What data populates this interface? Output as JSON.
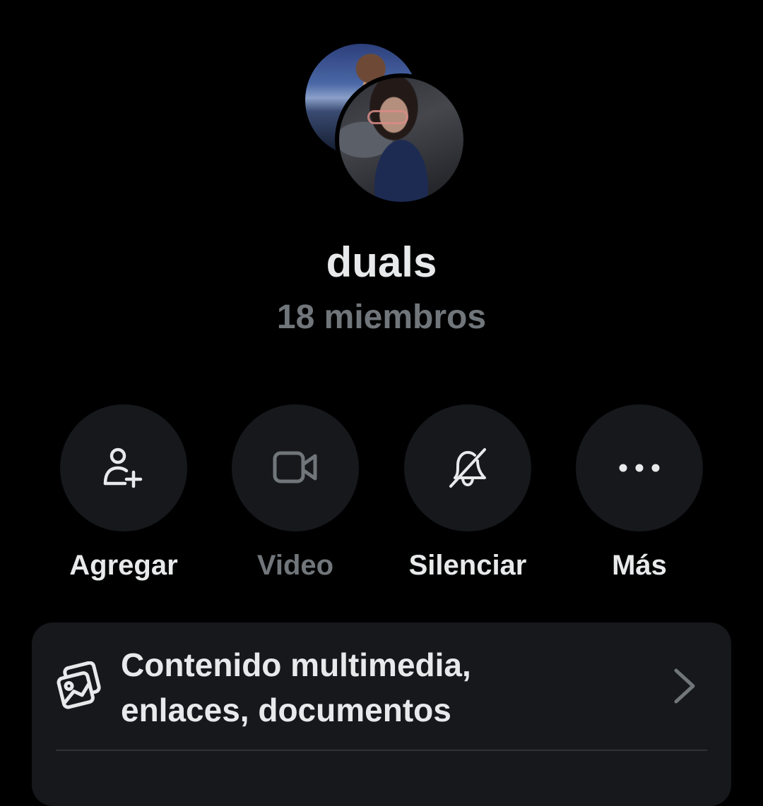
{
  "group": {
    "name": "duals",
    "members": "18 miembros"
  },
  "actions": [
    {
      "label": "Agregar",
      "icon": "add-user-icon",
      "enabled": true
    },
    {
      "label": "Video",
      "icon": "video-camera-icon",
      "enabled": false
    },
    {
      "label": "Silenciar",
      "icon": "bell-mute-icon",
      "enabled": true
    },
    {
      "label": "Más",
      "icon": "more-dots-icon",
      "enabled": true
    }
  ],
  "media": {
    "line1": "Contenido multimedia,",
    "line2": "enlaces, documentos",
    "icon": "media-gallery-icon"
  },
  "colors": {
    "background": "#000000",
    "surface": "#16181c",
    "text_primary": "#e7e9ea",
    "text_secondary": "#71767b"
  }
}
